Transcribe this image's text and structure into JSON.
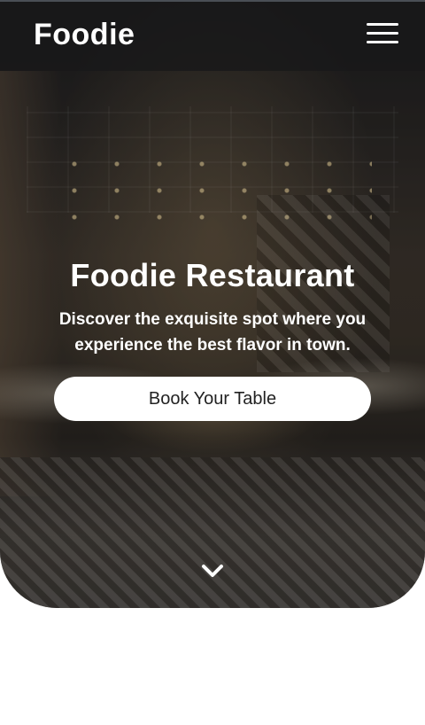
{
  "brand": {
    "name": "Foodie"
  },
  "nav": {
    "menu_icon": "hamburger-menu-icon"
  },
  "hero": {
    "title": "Foodie Restaurant",
    "subtitle": "Discover the exquisite spot where you experience the best flavor in town.",
    "cta_label": "Book Your Table",
    "scroll_icon": "chevron-down-icon",
    "background_image": "restaurant interior photo"
  },
  "colors": {
    "navbar_bg": "#18181a",
    "text": "#ffffff",
    "button_bg": "#ffffff",
    "button_text": "#222222",
    "page_bg": "#ffffff"
  }
}
